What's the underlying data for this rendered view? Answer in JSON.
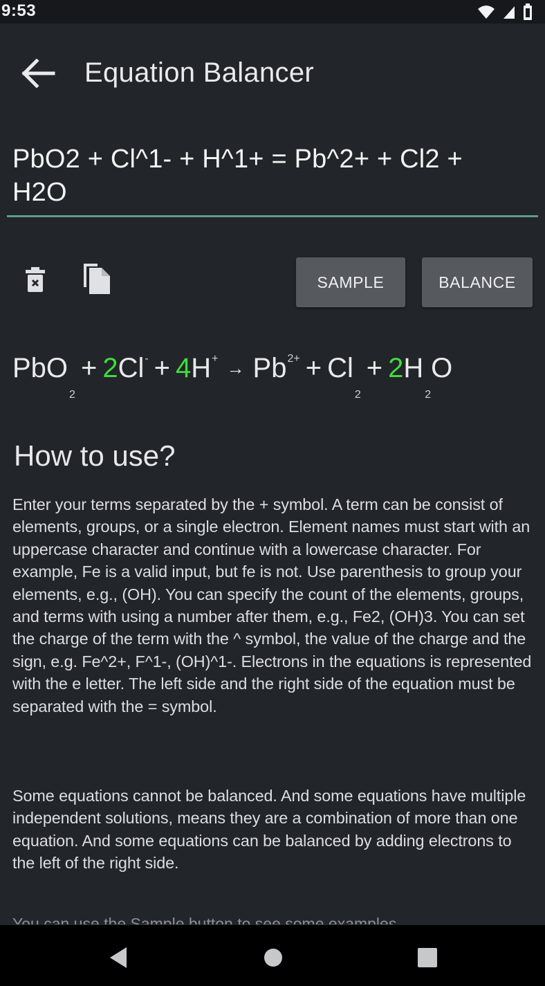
{
  "status_bar": {
    "time": "9:53",
    "icons": [
      "wifi-icon",
      "signal-icon",
      "battery-icon"
    ]
  },
  "app_bar": {
    "back_icon": "arrow-left-icon",
    "title": "Equation Balancer"
  },
  "equation_input": {
    "value": "PbO2 + Cl^1- + H^1+ = Pb^2+ + Cl2 + H2O"
  },
  "actions": {
    "clear_icon": "trash-icon",
    "copy_icon": "copy-icon",
    "sample_label": "SAMPLE",
    "balance_label": "BALANCE"
  },
  "result": {
    "accent_color": "#3fdc3c",
    "arrow": "→",
    "left_terms": [
      {
        "coef": "",
        "formula": "PbO",
        "sub": "2",
        "sup": ""
      },
      {
        "coef": "2",
        "formula": "Cl",
        "sub": "",
        "sup": "-"
      },
      {
        "coef": "4",
        "formula": "H",
        "sub": "",
        "sup": "+"
      }
    ],
    "right_terms": [
      {
        "coef": "",
        "formula": "Pb",
        "sub": "",
        "sup": "2+"
      },
      {
        "coef": "",
        "formula": "Cl",
        "sub": "2",
        "sup": ""
      },
      {
        "coef": "2",
        "formula": "H",
        "sub": "2",
        "sup": "",
        "tail": "O"
      }
    ]
  },
  "help": {
    "title": "How to use?",
    "paragraph1": "Enter your terms separated by the + symbol. A term can be consist of elements, groups, or a single electron. Element names must start with an uppercase character and continue with a lowercase character. For example, Fe is a valid input, but fe is not. Use parenthesis to group your elements, e.g., (OH). You can specify the count of the elements, groups, and terms with using a number after them, e.g., Fe2, (OH)3. You can set the charge of the term with the ^ symbol, the value of the charge and the sign, e.g. Fe^2+, F^1-, (OH)^1-. Electrons in the equations is represented with the e letter. The left side and the right side of the equation must be separated with the = symbol.",
    "paragraph2": "Some equations cannot be balanced. And some equations have multiple independent solutions, means they are a combination of more than one equation. And some equations can be balanced by adding electrons to the left of the right side.",
    "paragraph3_partial": "You can use the Sample button to see some examples"
  },
  "nav_bar": {
    "back_icon": "nav-back-icon",
    "home_icon": "nav-home-icon",
    "recents_icon": "nav-recents-icon"
  }
}
